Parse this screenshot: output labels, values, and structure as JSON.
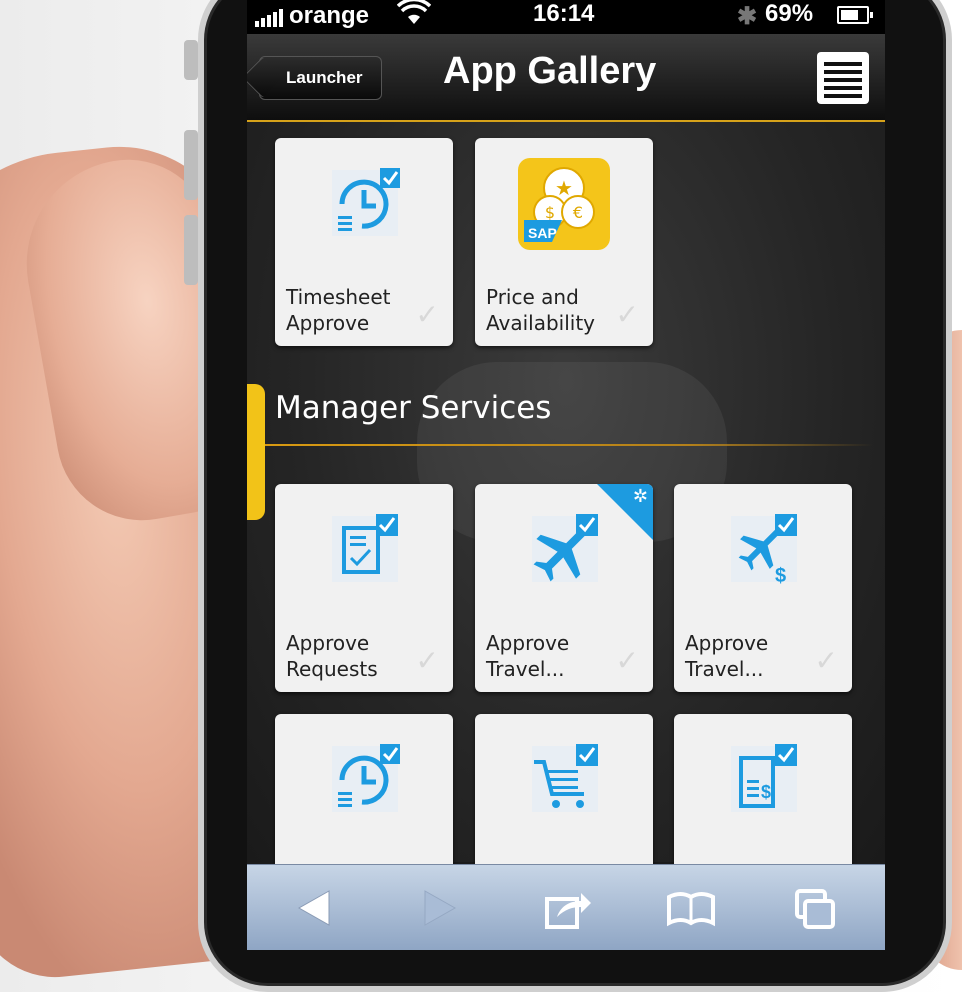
{
  "status_bar": {
    "carrier": "orange",
    "time": "16:14",
    "battery": "69%"
  },
  "nav": {
    "back_label": "Launcher",
    "title": "App Gallery"
  },
  "top_tiles": [
    {
      "label_line1": "Timesheet",
      "label_line2": "Approve",
      "icon": "timesheet-icon"
    },
    {
      "label_line1": "Price and",
      "label_line2": "Availability",
      "icon": "sap-price-icon"
    }
  ],
  "section": {
    "title": "Manager Services"
  },
  "manager_tiles": [
    {
      "label_line1": "Approve",
      "label_line2": "Requests",
      "icon": "approve-requests-icon",
      "badge": false
    },
    {
      "label_line1": "Approve",
      "label_line2": "Travel...",
      "icon": "travel-approve-icon",
      "badge": true
    },
    {
      "label_line1": "Approve",
      "label_line2": "Travel...",
      "icon": "travel-expense-icon",
      "badge": false
    },
    {
      "label_line1": "",
      "label_line2": "",
      "icon": "timesheet-icon",
      "badge": false
    },
    {
      "label_line1": "",
      "label_line2": "",
      "icon": "shopping-cart-icon",
      "badge": false
    },
    {
      "label_line1": "",
      "label_line2": "",
      "icon": "invoice-icon",
      "badge": false
    }
  ],
  "toolbar": [
    "back-arrow-icon",
    "forward-arrow-icon",
    "share-icon",
    "bookmarks-icon",
    "tabs-icon"
  ],
  "colors": {
    "accent": "#f2c318",
    "icon_blue": "#1d9be0",
    "toolbar": "#a9bcd6"
  }
}
